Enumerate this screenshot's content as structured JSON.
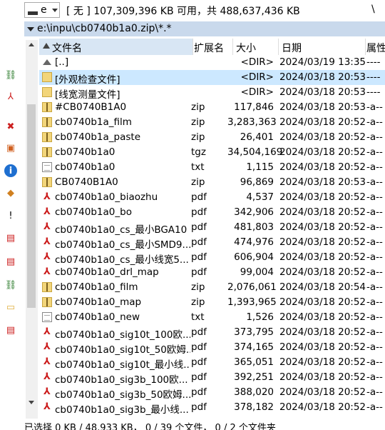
{
  "drivebar": {
    "drive_letter": "e",
    "info": "[ 无 ]  107,309,396 KB 可用，共 488,637,436 KB",
    "root": "\\"
  },
  "pathbar": {
    "path": "e:\\inpu\\cb0740b1a0.zip\\*.*",
    "star": "*"
  },
  "toolbar": [
    {
      "icon": "network-icon",
      "glyph": "⛓",
      "color": "#2a7a2a"
    },
    {
      "icon": "pdf-icon",
      "glyph": "⅄",
      "color": "#cc1f1f"
    },
    {
      "icon": "disconnect-icon",
      "glyph": "✖",
      "color": "#cc1f1f"
    },
    {
      "icon": "image-icon",
      "glyph": "▣",
      "color": "#d06020"
    },
    {
      "icon": "info-icon",
      "glyph": "i",
      "color": "#ffffff"
    },
    {
      "icon": "shield-icon",
      "glyph": "◆",
      "color": "#d08020"
    },
    {
      "icon": "warning-icon",
      "glyph": "!",
      "color": "#000000"
    },
    {
      "icon": "pdf-document-icon",
      "glyph": "▤",
      "color": "#cc1f1f"
    },
    {
      "icon": "pdf-document-icon-2",
      "glyph": "▤",
      "color": "#cc1f1f"
    },
    {
      "icon": "network-icon-2",
      "glyph": "⛓",
      "color": "#2a7a2a"
    },
    {
      "icon": "folder-icon",
      "glyph": "▭",
      "color": "#e0b040"
    },
    {
      "icon": "pdf-document-icon-3",
      "glyph": "▤",
      "color": "#cc1f1f"
    }
  ],
  "columns": {
    "name": "文件名",
    "ext": "扩展名",
    "size": "大小",
    "date": "日期",
    "attr": "属性"
  },
  "rows": [
    {
      "icon": "up",
      "name": "[..]",
      "ext": "",
      "size": "<DIR>",
      "date": "2024/03/19 13:35",
      "attr": "----"
    },
    {
      "icon": "folder",
      "name": "[外观检查文件]",
      "ext": "",
      "size": "<DIR>",
      "date": "2024/03/18 20:53",
      "attr": "----",
      "selected": true
    },
    {
      "icon": "folder",
      "name": "[线宽测量文件]",
      "ext": "",
      "size": "<DIR>",
      "date": "2024/03/18 20:53",
      "attr": "----"
    },
    {
      "icon": "zip",
      "name": "#CB0740B1A0",
      "ext": "zip",
      "size": "117,846",
      "date": "2024/03/18 20:53",
      "attr": "-a--"
    },
    {
      "icon": "zip",
      "name": "cb0740b1a_film",
      "ext": "zip",
      "size": "3,283,363",
      "date": "2024/03/18 20:52",
      "attr": "-a--"
    },
    {
      "icon": "zip",
      "name": "cb0740b1a_paste",
      "ext": "zip",
      "size": "26,401",
      "date": "2024/03/18 20:52",
      "attr": "-a--"
    },
    {
      "icon": "zip",
      "name": "cb0740b1a0",
      "ext": "tgz",
      "size": "34,504,169",
      "date": "2024/03/18 20:52",
      "attr": "-a--"
    },
    {
      "icon": "txt",
      "name": "cb0740b1a0",
      "ext": "txt",
      "size": "1,115",
      "date": "2024/03/18 20:52",
      "attr": "-a--"
    },
    {
      "icon": "zip",
      "name": "CB0740B1A0",
      "ext": "zip",
      "size": "96,869",
      "date": "2024/03/18 20:53",
      "attr": "-a--"
    },
    {
      "icon": "pdf",
      "name": "cb0740b1a0_biaozhu",
      "ext": "pdf",
      "size": "4,537",
      "date": "2024/03/18 20:52",
      "attr": "-a--"
    },
    {
      "icon": "pdf",
      "name": "cb0740b1a0_bo",
      "ext": "pdf",
      "size": "342,906",
      "date": "2024/03/18 20:52",
      "attr": "-a--"
    },
    {
      "icon": "pdf",
      "name": "cb0740b1a0_cs_最小BGA10",
      "ext": "pdf",
      "size": "481,803",
      "date": "2024/03/18 20:52",
      "attr": "-a--"
    },
    {
      "icon": "pdf",
      "name": "cb0740b1a0_cs_最小SMD9...",
      "ext": "pdf",
      "size": "474,976",
      "date": "2024/03/18 20:52",
      "attr": "-a--"
    },
    {
      "icon": "pdf",
      "name": "cb0740b1a0_cs_最小线宽5...",
      "ext": "pdf",
      "size": "606,904",
      "date": "2024/03/18 20:52",
      "attr": "-a--"
    },
    {
      "icon": "pdf",
      "name": "cb0740b1a0_drl_map",
      "ext": "pdf",
      "size": "99,004",
      "date": "2024/03/18 20:52",
      "attr": "-a--"
    },
    {
      "icon": "zip",
      "name": "cb0740b1a0_film",
      "ext": "zip",
      "size": "2,076,061",
      "date": "2024/03/18 20:54",
      "attr": "-a--"
    },
    {
      "icon": "zip",
      "name": "cb0740b1a0_map",
      "ext": "zip",
      "size": "1,393,965",
      "date": "2024/03/18 20:52",
      "attr": "-a--"
    },
    {
      "icon": "txt",
      "name": "cb0740b1a0_new",
      "ext": "txt",
      "size": "1,526",
      "date": "2024/03/18 20:52",
      "attr": "-a--"
    },
    {
      "icon": "pdf",
      "name": "cb0740b1a0_sig10t_100欧...",
      "ext": "pdf",
      "size": "373,795",
      "date": "2024/03/18 20:52",
      "attr": "-a--"
    },
    {
      "icon": "pdf",
      "name": "cb0740b1a0_sig10t_50欧姆...",
      "ext": "pdf",
      "size": "374,165",
      "date": "2024/03/18 20:52",
      "attr": "-a--"
    },
    {
      "icon": "pdf",
      "name": "cb0740b1a0_sig10t_最小线...",
      "ext": "pdf",
      "size": "365,051",
      "date": "2024/03/18 20:52",
      "attr": "-a--"
    },
    {
      "icon": "pdf",
      "name": "cb0740b1a0_sig3b_100欧...",
      "ext": "pdf",
      "size": "392,251",
      "date": "2024/03/18 20:52",
      "attr": "-a--"
    },
    {
      "icon": "pdf",
      "name": "cb0740b1a0_sig3b_50欧姆...",
      "ext": "pdf",
      "size": "388,020",
      "date": "2024/03/18 20:52",
      "attr": "-a--"
    },
    {
      "icon": "pdf",
      "name": "cb0740b1a0_sig3b_最小线...",
      "ext": "pdf",
      "size": "378,182",
      "date": "2024/03/18 20:52",
      "attr": "-a--"
    }
  ],
  "status": "已选择 0 KB / 48,933 KB，  0 / 39 个文件，  0 / 2 个文件夹"
}
